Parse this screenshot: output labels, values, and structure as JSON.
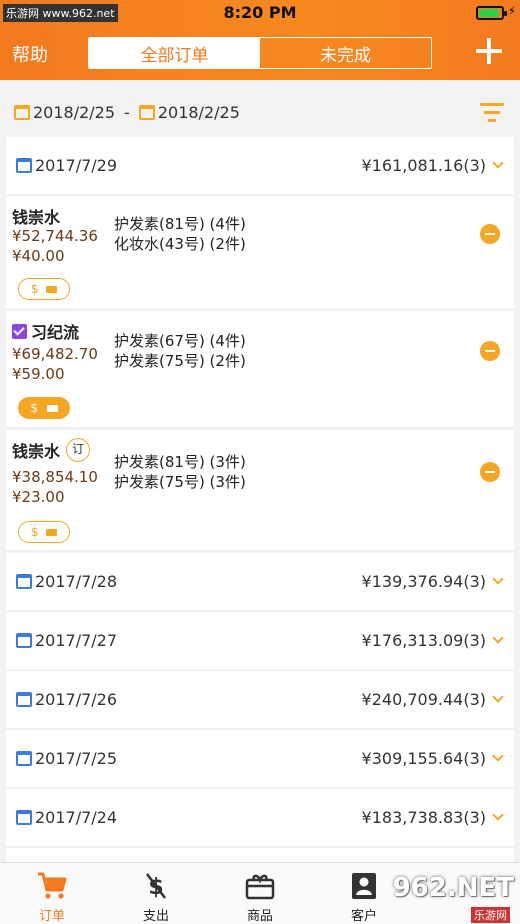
{
  "status": {
    "watermark": "乐游网 www.962.net",
    "time": "8:20 PM"
  },
  "header": {
    "help": "帮助",
    "tabs": [
      {
        "label": "全部订单"
      },
      {
        "label": "未完成"
      }
    ]
  },
  "filter": {
    "start": "2018/2/25",
    "separator": "-",
    "end": "2018/2/25"
  },
  "days": [
    {
      "date": "2017/7/29",
      "total": "¥161,081.16(3)"
    },
    {
      "date": "2017/7/28",
      "total": "¥139,376.94(3)"
    },
    {
      "date": "2017/7/27",
      "total": "¥176,313.09(3)"
    },
    {
      "date": "2017/7/26",
      "total": "¥240,709.44(3)"
    },
    {
      "date": "2017/7/25",
      "total": "¥309,155.64(3)"
    },
    {
      "date": "2017/7/24",
      "total": "¥183,738.83(3)"
    }
  ],
  "orders": [
    {
      "customer": "钱崇水",
      "amount": "¥52,744.36",
      "fee": "¥40.00",
      "item1": "护发素(81号) (4件)",
      "item2": "化妆水(43号) (2件)",
      "checked": false,
      "ding": "",
      "pill_filled": false
    },
    {
      "customer": "习纪流",
      "amount": "¥69,482.70",
      "fee": "¥59.00",
      "item1": "护发素(67号) (4件)",
      "item2": "护发素(75号) (2件)",
      "checked": true,
      "ding": "",
      "pill_filled": true
    },
    {
      "customer": "钱崇水",
      "amount": "¥38,854.10",
      "fee": "¥23.00",
      "item1": "护发素(81号) (3件)",
      "item2": "护发素(75号) (3件)",
      "checked": false,
      "ding": "订",
      "pill_filled": false
    }
  ],
  "pill": {
    "dollar": "$"
  },
  "tabbar": [
    {
      "label": "订单"
    },
    {
      "label": "支出"
    },
    {
      "label": "商品"
    },
    {
      "label": "客户"
    }
  ],
  "watermark_br": {
    "text": "962.NET",
    "sub": "乐游网"
  },
  "colors": {
    "accent": "#f37a1f",
    "amber": "#f5a623",
    "calendar_blue": "#3b7be0"
  }
}
